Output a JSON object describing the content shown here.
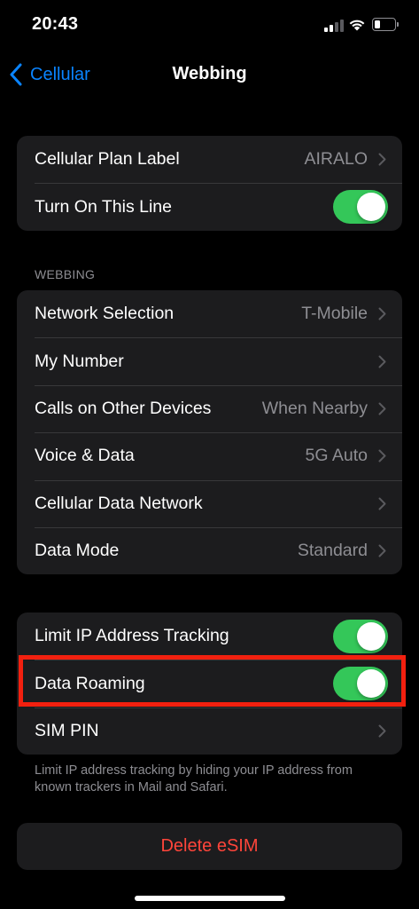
{
  "status_bar": {
    "time": "20:43"
  },
  "nav": {
    "back_label": "Cellular",
    "title": "Webbing"
  },
  "group1": {
    "rows": [
      {
        "label": "Cellular Plan Label",
        "value": "AIRALO"
      },
      {
        "label": "Turn On This Line",
        "toggle": true
      }
    ]
  },
  "section_header": "WEBBING",
  "group2": {
    "rows": [
      {
        "label": "Network Selection",
        "value": "T-Mobile"
      },
      {
        "label": "My Number",
        "value": ""
      },
      {
        "label": "Calls on Other Devices",
        "value": "When Nearby"
      },
      {
        "label": "Voice & Data",
        "value": "5G Auto"
      },
      {
        "label": "Cellular Data Network",
        "value": ""
      },
      {
        "label": "Data Mode",
        "value": "Standard"
      }
    ]
  },
  "group3": {
    "rows": [
      {
        "label": "Limit IP Address Tracking",
        "toggle": true
      },
      {
        "label": "Data Roaming",
        "toggle": true
      },
      {
        "label": "SIM PIN",
        "value": ""
      }
    ],
    "footer": "Limit IP address tracking by hiding your IP address from known trackers in Mail and Safari."
  },
  "delete_button": "Delete eSIM",
  "colors": {
    "accent": "#0a84ff",
    "toggle_on": "#34c759",
    "destructive": "#ff453a",
    "highlight": "#f2200f"
  },
  "icons": [
    "chevron-left-icon",
    "chevron-right-icon",
    "cellular-signal-icon",
    "wifi-icon",
    "battery-icon"
  ]
}
